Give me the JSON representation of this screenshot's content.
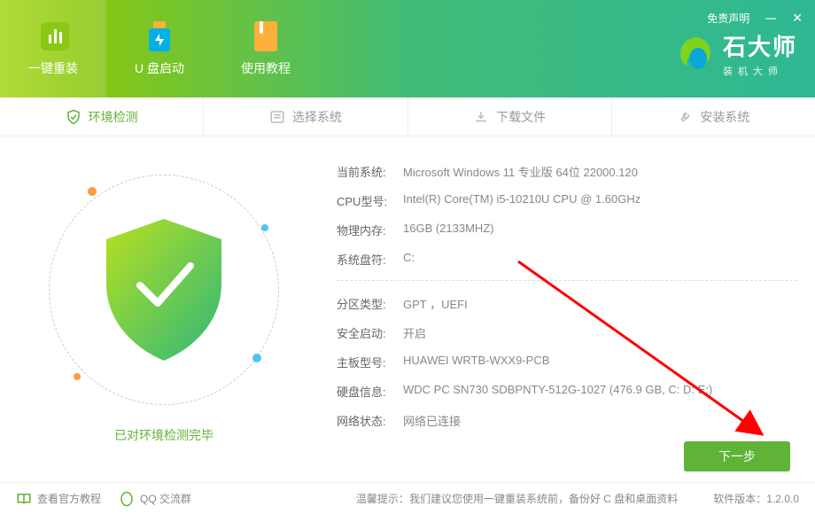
{
  "titlebar": {
    "disclaimer": "免责声明"
  },
  "tabs": [
    {
      "label": "一键重装"
    },
    {
      "label": "U 盘启动"
    },
    {
      "label": "使用教程"
    }
  ],
  "brand": {
    "name": "石大师",
    "sub": "装机大师"
  },
  "steps": [
    {
      "label": "环境检测"
    },
    {
      "label": "选择系统"
    },
    {
      "label": "下载文件"
    },
    {
      "label": "安装系统"
    }
  ],
  "status": "已对环境检测完毕",
  "info": {
    "os_label": "当前系统:",
    "os": "Microsoft Windows 11 专业版 64位 22000.120",
    "cpu_label": "CPU型号:",
    "cpu": "Intel(R) Core(TM) i5-10210U CPU @ 1.60GHz",
    "ram_label": "物理内存:",
    "ram": "16GB (2133MHZ)",
    "sysdrive_label": "系统盘符:",
    "sysdrive": "C:",
    "part_label": "分区类型:",
    "part": "GPT ，UEFI",
    "secure_label": "安全启动:",
    "secure": "开启",
    "board_label": "主板型号:",
    "board": "HUAWEI WRTB-WXX9-PCB",
    "disk_label": "硬盘信息:",
    "disk": "WDC PC SN730 SDBPNTY-512G-1027  (476.9 GB, C: D: E:)",
    "net_label": "网络状态:",
    "net": "网络已连接"
  },
  "next": "下一步",
  "footer": {
    "tutorial": "查看官方教程",
    "qq": "QQ 交流群",
    "tip_label": "温馨提示：",
    "tip": "我们建议您使用一键重装系统前，备份好 C 盘和桌面资料",
    "ver_label": "软件版本：",
    "ver": "1.2.0.0"
  }
}
